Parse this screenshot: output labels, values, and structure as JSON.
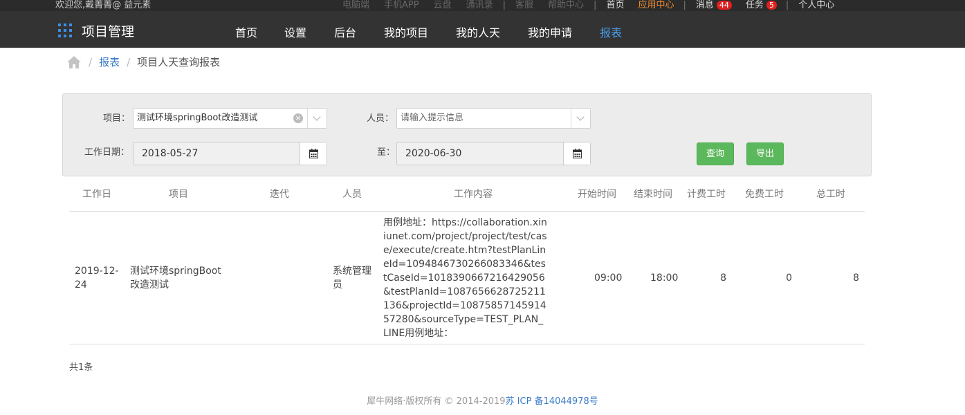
{
  "topbar": {
    "welcome": "欢迎您,戴菁菁@ 益元素",
    "links": [
      "电脑端",
      "手机APP",
      "云盘",
      "通讯录"
    ],
    "links2": [
      "客服",
      "帮助中心"
    ],
    "home": "首页",
    "app_center": "应用中心",
    "messages_label": "消息",
    "messages_count": "44",
    "tasks_label": "任务",
    "tasks_count": "5",
    "personal": "个人中心"
  },
  "navbar": {
    "app_name": "项目管理",
    "items": [
      "首页",
      "设置",
      "后台",
      "我的项目",
      "我的人天",
      "我的申请",
      "报表"
    ],
    "active": "报表"
  },
  "breadcrumb": {
    "parent": "报表",
    "current": "项目人天查询报表"
  },
  "filters": {
    "project_label": "项目：",
    "project_value": "测试环境springBoot改造测试",
    "person_label": "人员：",
    "person_placeholder": "请输入提示信息",
    "date_label": "工作日期：",
    "date_from": "2018-05-27",
    "to_label": "至：",
    "date_to": "2020-06-30",
    "query_button": "查询",
    "export_button": "导出"
  },
  "table": {
    "headers": [
      "工作日",
      "项目",
      "迭代",
      "人员",
      "工作内容",
      "开始时间",
      "结束时间",
      "计费工时",
      "免费工时",
      "总工时"
    ],
    "rows": [
      {
        "workday": "2019-12-24",
        "project": "测试环境springBoot改造测试",
        "iteration": "",
        "person": "系统管理员",
        "content": "用例地址：https://collaboration.xiniunet.com/project/project/test/case/execute/create.htm?testPlanLineId=1094846730266083346&testCaseId=1018390667216429056&testPlanId=1087656628725211136&projectId=1087585714591457280&sourceType=TEST_PLAN_LINE用例地址：",
        "start": "09:00",
        "end": "18:00",
        "billable": "8",
        "free": "0",
        "total": "8"
      }
    ]
  },
  "summary": "共1条",
  "footer": {
    "copyright": "犀牛网络·版权所有 © 2014-2019",
    "icp": "苏 ICP 备14044978号"
  },
  "colors": {
    "nav_bg": "#333333",
    "topbar_bg": "#2b2b2b",
    "accent_orange": "#f08c2f",
    "accent_blue": "#4aa0f0",
    "button_green": "#5cb85c",
    "badge_red": "#e02020"
  }
}
